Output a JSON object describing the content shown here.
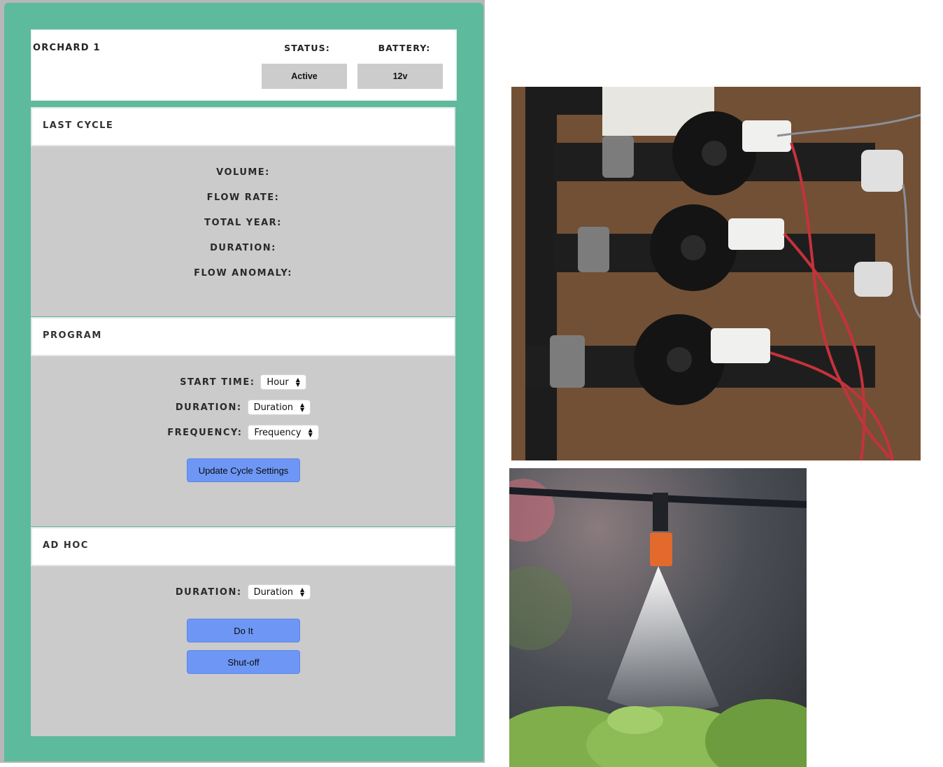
{
  "header": {
    "title": "ORCHARD 1",
    "status_label": "STATUS:",
    "status_value": "Active",
    "battery_label": "BATTERY:",
    "battery_value": "12v"
  },
  "last_cycle": {
    "title": "LAST CYCLE",
    "fields": [
      "VOLUME:",
      "FLOW RATE:",
      "TOTAL YEAR:",
      "DURATION:",
      "FLOW ANOMALY:"
    ]
  },
  "program": {
    "title": "PROGRAM",
    "start_time_label": "START TIME:",
    "start_time_value": "Hour",
    "duration_label": "DURATION:",
    "duration_value": "Duration",
    "frequency_label": "FREQUENCY:",
    "frequency_value": "Frequency",
    "update_button": "Update Cycle Settings"
  },
  "ad_hoc": {
    "title": "AD HOC",
    "duration_label": "DURATION:",
    "duration_value": "Duration",
    "do_it_button": "Do It",
    "shutoff_button": "Shut-off"
  },
  "images": {
    "valves_photo": "solenoid-valve-manifold-photo",
    "sprinkler_photo": "mist-sprinkler-photo"
  },
  "colors": {
    "frame_green": "#5dba9c",
    "panel_gray": "#cbcbcb",
    "button_blue": "#6e97f5"
  }
}
